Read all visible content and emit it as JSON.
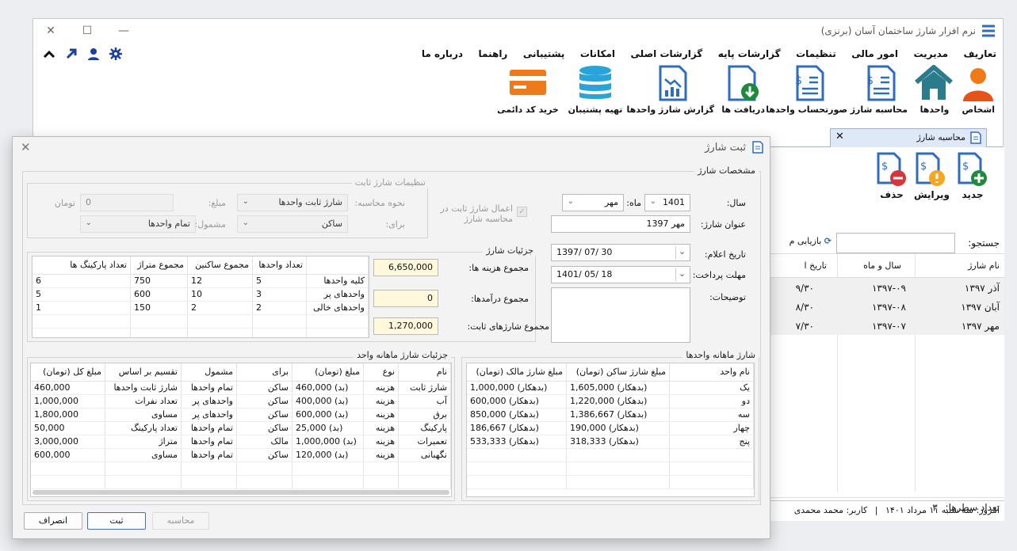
{
  "app": {
    "title": "نرم افزار شارژ ساختمان آسان (برنزی)",
    "menu": [
      "تعاریف",
      "مدیریت",
      "امور مالی",
      "تنظیمات",
      "گزارشات پایه",
      "گزارشات اصلی",
      "امکانات",
      "پشتیبانی",
      "راهنما",
      "درباره ما"
    ],
    "toolbar": [
      "اشخاص",
      "واحدها",
      "محاسبه شارژ",
      "صورتحساب واحدها",
      "دریافت ها",
      "گزارش شارژ واحدها",
      "تهیه پشتیبان",
      "خرید کد دائمی"
    ],
    "tab_label": "محاسبه شارژ",
    "colors": {
      "accent": "#2d6cc0",
      "orange": "#f07a1a",
      "teal": "#2a7c8c"
    }
  },
  "right_panel": {
    "actions": [
      "جدید",
      "ویرایش",
      "حذف"
    ],
    "search_label": "جستجو:",
    "search_value": "",
    "refresh_label": "بازیابی م",
    "columns": [
      "نام شارژ",
      "سال و ماه",
      "تاریخ ا"
    ],
    "rows": [
      {
        "name": "آذر ۱۳۹۷",
        "ym": "۱۳۹۷-۰۹",
        "date": "۹/۳۰"
      },
      {
        "name": "آبان ۱۳۹۷",
        "ym": "۱۳۹۷-۰۸",
        "date": "۸/۳۰"
      },
      {
        "name": "مهر ۱۳۹۷",
        "ym": "۱۳۹۷-۰۷",
        "date": "۷/۳۰"
      }
    ],
    "row_count_label": "تعداد سطرها:",
    "row_count": "۳"
  },
  "statusbar": {
    "today": "امروز: سه شنبه ۱۱ مرداد ۱۴۰۱",
    "user": "کاربر: محمد محمدی"
  },
  "dialog": {
    "title": "ثبت شارژ",
    "spec_group": "مشخصات شارژ",
    "year_label": "سال:",
    "year_value": "1401",
    "month_label": "ماه:",
    "month_value": "مهر",
    "charge_title_label": "عنوان شارژ:",
    "charge_title_value": "مهر 1397",
    "announce_date_label": "تاریخ اعلام:",
    "announce_date_value": "1397/ 07/ 30",
    "due_date_label": "مهلت  پرداخت:",
    "due_date_value": "1401/ 05/ 18",
    "notes_label": "توضیحات:",
    "notes_value": "",
    "fixed_group": "تنظیمات شارژ ثابت",
    "apply_fixed_label": "اعمال شارژ ثابت در محاسبه شارژ",
    "method_label": "نحوه محاسبه:",
    "method_value": "شارژ ثابت واحدها",
    "amount_label": "مبلغ:",
    "amount_value": "0",
    "currency": "تومان",
    "for_label": "برای:",
    "for_value": "ساکن",
    "include_label": "مشمول:",
    "include_value": "تمام واحدها",
    "details_group": "جزئیات شارژ",
    "total_expense_label": "مجموع هزینه ها:",
    "total_expense_value": "6,650,000",
    "total_income_label": "مجموع درآمدها:",
    "total_income_value": "0",
    "total_fixed_label": "مجموع شارژهای ثابت:",
    "total_fixed_value": "1,270,000",
    "units_table": {
      "columns": [
        "",
        "تعداد واحدها",
        "مجموع ساکنین",
        "مجموع متراژ",
        "تعداد پارکینگ ها"
      ],
      "rows": [
        [
          "کلیه واحدها",
          "5",
          "12",
          "750",
          "6"
        ],
        [
          "واحدهای پر",
          "3",
          "10",
          "600",
          "5"
        ],
        [
          "واحدهای خالی",
          "2",
          "2",
          "150",
          "1"
        ]
      ]
    },
    "unit_monthly_group": "شارژ ماهانه واحدها",
    "unit_monthly": {
      "columns": [
        "نام واحد",
        "مبلغ شارژ ساکن (تومان)",
        "مبلغ شارژ مالک (تومان)"
      ],
      "rows": [
        [
          "یک",
          "1,605,000 (بدهکار)",
          "1,000,000 (بدهکار)"
        ],
        [
          "دو",
          "1,220,000 (بدهکار)",
          "600,000 (بدهکار)"
        ],
        [
          "سه",
          "1,386,667 (بدهکار)",
          "850,000 (بدهکار)"
        ],
        [
          "چهار",
          "190,000 (بدهکار)",
          "186,667 (بدهکار)"
        ],
        [
          "پنج",
          "318,333 (بدهکار)",
          "533,333 (بدهکار)"
        ]
      ]
    },
    "monthly_detail_group": "جزئیات شارژ ماهانه واحد",
    "monthly_detail": {
      "columns": [
        "نام",
        "نوع",
        "مبلغ (تومان)",
        "برای",
        "مشمول",
        "تقسیم بر اساس",
        "مبلغ کل (تومان)"
      ],
      "rows": [
        [
          "شارژ ثابت",
          "هزینه",
          "460,000 (بد)",
          "ساکن",
          "تمام واحدها",
          "شارژ ثابت واحدها",
          "460,000"
        ],
        [
          "آب",
          "هزینه",
          "400,000 (بد)",
          "ساکن",
          "واحدهای پر",
          "تعداد نفرات",
          "1,000,000"
        ],
        [
          "برق",
          "هزینه",
          "600,000 (بد)",
          "ساکن",
          "واحدهای پر",
          "مساوی",
          "1,800,000"
        ],
        [
          "پارکینگ",
          "هزینه",
          "25,000 (بد)",
          "ساکن",
          "تمام واحدها",
          "تعداد پارکینگ",
          "50,000"
        ],
        [
          "تعمیرات",
          "هزینه",
          "1,000,000 (بد)",
          "مالک",
          "تمام واحدها",
          "متراژ",
          "3,000,000"
        ],
        [
          "نگهبانی",
          "هزینه",
          "120,000 (بد)",
          "ساکن",
          "تمام واحدها",
          "مساوی",
          "600,000"
        ]
      ]
    },
    "btn_calc": "محاسبه",
    "btn_save": "ثبت",
    "btn_cancel": "انصراف"
  }
}
